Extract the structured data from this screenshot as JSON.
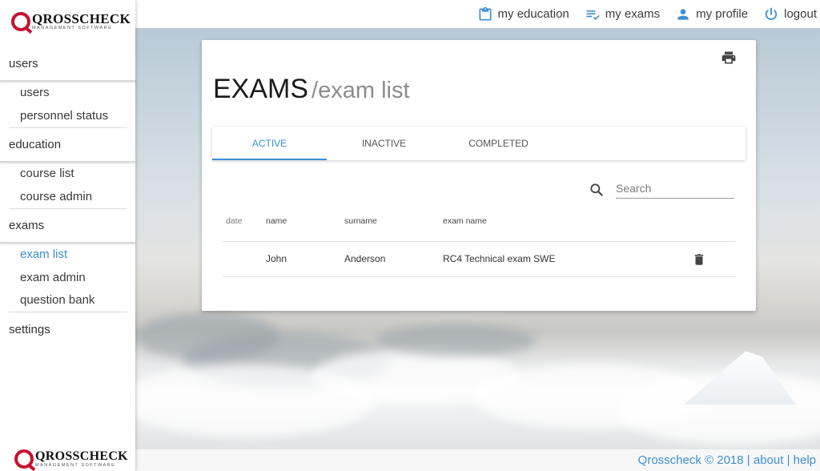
{
  "brand": {
    "name": "QROSSCHECK",
    "tagline": "MANAGEMENT SOFTWARE",
    "accent_color": "#c8102e"
  },
  "topnav": {
    "my_education": "my education",
    "my_exams": "my exams",
    "my_profile": "my profile",
    "logout": "logout",
    "icons": [
      "clipboard-icon",
      "checklist-icon",
      "person-icon",
      "power-icon"
    ]
  },
  "sidebar": {
    "users_head": "users",
    "users": "users",
    "personnel_status": "personnel status",
    "education_head": "education",
    "course_list": "course list",
    "course_admin": "course admin",
    "exams_head": "exams",
    "exam_list": "exam list",
    "exam_admin": "exam admin",
    "question_bank": "question bank",
    "settings_head": "settings",
    "active_color": "#3d8fd1"
  },
  "page": {
    "title": "EXAMS",
    "subtitle": "/exam list"
  },
  "tabs": {
    "active": "ACTIVE",
    "inactive": "INACTIVE",
    "completed": "COMPLETED"
  },
  "search": {
    "placeholder": "Search",
    "value": ""
  },
  "table": {
    "headers": {
      "date": "date",
      "name": "name",
      "surname": "surname",
      "exam_name": "exam name"
    },
    "rows": [
      {
        "date": "",
        "name": "John",
        "surname": "Anderson",
        "exam_name": "RC4 Technical exam SWE"
      }
    ]
  },
  "footer": {
    "copyright": "Qrosscheck © 2018",
    "sep": " | ",
    "about": "about",
    "help": "help"
  }
}
